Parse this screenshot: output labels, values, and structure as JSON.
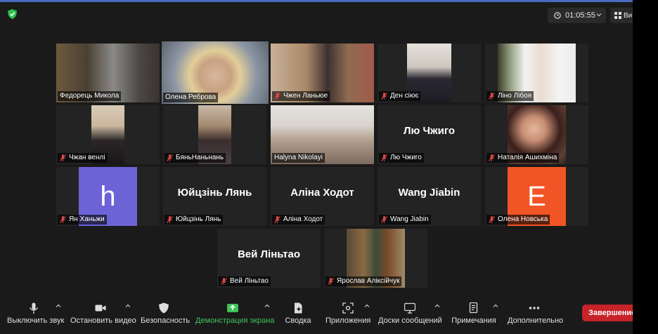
{
  "top": {
    "timer": "01:05:55",
    "view_label": "Ви"
  },
  "participants": [
    {
      "name": "Федорець Микола",
      "muted": false
    },
    {
      "name": "Олена Реброва",
      "muted": false
    },
    {
      "name": "Чжен Ланьюе",
      "muted": true
    },
    {
      "name": "Ден сіює",
      "muted": true
    },
    {
      "name": "Ліно Лібоя",
      "muted": true
    },
    {
      "name": "Чжан венлі",
      "muted": true
    },
    {
      "name": "БяньНаньнань",
      "muted": true
    },
    {
      "name": "Halyna Nikolayi",
      "muted": false
    },
    {
      "name": "Лю Чжиго",
      "muted": true,
      "display_name": "Лю Чжиго"
    },
    {
      "name": "Наталія Ашихміна",
      "muted": true
    },
    {
      "name": "Ян Ханьжи",
      "muted": true,
      "avatar_letter": "h",
      "avatar_color": "#6c64d6"
    },
    {
      "name": "Юйцзінь Лянь",
      "muted": true,
      "display_name": "Юйцзінь Лянь"
    },
    {
      "name": "Аліна Ходот",
      "muted": true,
      "display_name": "Аліна Ходот"
    },
    {
      "name": "Wang Jiabin",
      "muted": true,
      "display_name": "Wang Jiabin"
    },
    {
      "name": "Олена Новська",
      "muted": true,
      "avatar_letter": "E",
      "avatar_color": "#f25525"
    },
    {
      "name": "Вей Ліньтао",
      "muted": true,
      "display_name": "Вей Ліньтао"
    },
    {
      "name": "Ярослав Аліксійчук",
      "muted": true
    }
  ],
  "toolbar": {
    "mute": "Выключить звук",
    "video": "Остановить видео",
    "security": "Безопасность",
    "share": "Демонстрация экрана",
    "summary": "Сводка",
    "apps": "Приложения",
    "whiteboard": "Доски сообщений",
    "notes": "Примечания",
    "more": "Дополнительно",
    "end": "Завершение"
  },
  "colors": {
    "share_green": "#3fc35a",
    "end_red": "#c6232a",
    "active_speaker": "#c9d34a"
  }
}
